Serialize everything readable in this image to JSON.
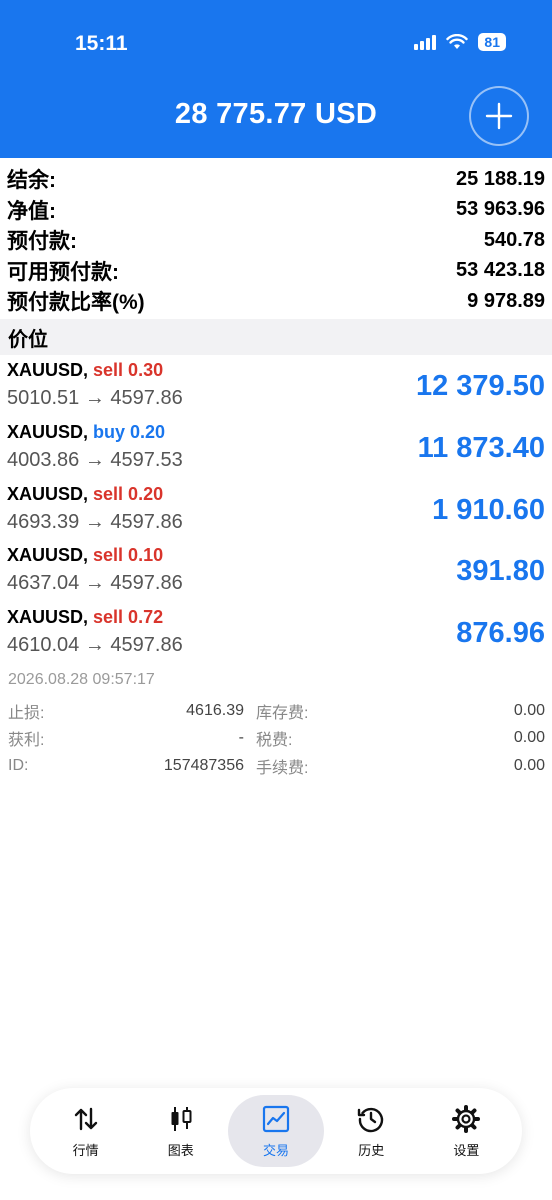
{
  "status": {
    "time": "15:11",
    "battery": "81"
  },
  "header": {
    "title": "28 775.77 USD"
  },
  "summary": [
    {
      "label": "结余:",
      "value": "25 188.19"
    },
    {
      "label": "净值:",
      "value": "53 963.96"
    },
    {
      "label": "预付款:",
      "value": "540.78"
    },
    {
      "label": "可用预付款:",
      "value": "53 423.18"
    },
    {
      "label": "预付款比率(%)",
      "value": "9 978.89"
    }
  ],
  "section": {
    "title": "价位"
  },
  "positions": [
    {
      "symbol": "XAUUSD,",
      "side": "sell 0.30",
      "prices": "5010.51 → 4597.86",
      "profit": "12 379.50"
    },
    {
      "symbol": "XAUUSD,",
      "side": "buy 0.20",
      "prices": "4003.86 → 4597.53",
      "profit": "11 873.40"
    },
    {
      "symbol": "XAUUSD,",
      "side": "sell 0.20",
      "prices": "4693.39 → 4597.86",
      "profit": "1 910.60"
    },
    {
      "symbol": "XAUUSD,",
      "side": "sell 0.10",
      "prices": "4637.04 → 4597.86",
      "profit": "391.80"
    },
    {
      "symbol": "XAUUSD,",
      "side": "sell 0.72",
      "prices": "4610.04 → 4597.86",
      "profit": "876.96"
    }
  ],
  "detail": {
    "time": "2026.08.28 09:57:17",
    "rows": [
      {
        "label1": "止损:",
        "value1": "4616.39",
        "label2": "库存费:",
        "value2": "0.00"
      },
      {
        "label1": "获利:",
        "value1": "-",
        "label2": "税费:",
        "value2": "0.00"
      },
      {
        "label1": "ID:",
        "value1": "157487356",
        "label2": "手续费:",
        "value2": "0.00"
      }
    ]
  },
  "nav": [
    {
      "label": "行情",
      "icon": "swap-arrows-icon"
    },
    {
      "label": "图表",
      "icon": "candlestick-icon"
    },
    {
      "label": "交易",
      "icon": "trade-chart-icon"
    },
    {
      "label": "历史",
      "icon": "history-clock-icon"
    },
    {
      "label": "设置",
      "icon": "gear-icon"
    }
  ],
  "colors": {
    "accent": "#1976ee",
    "sell": "#d9342b",
    "buy": "#1976ee"
  }
}
